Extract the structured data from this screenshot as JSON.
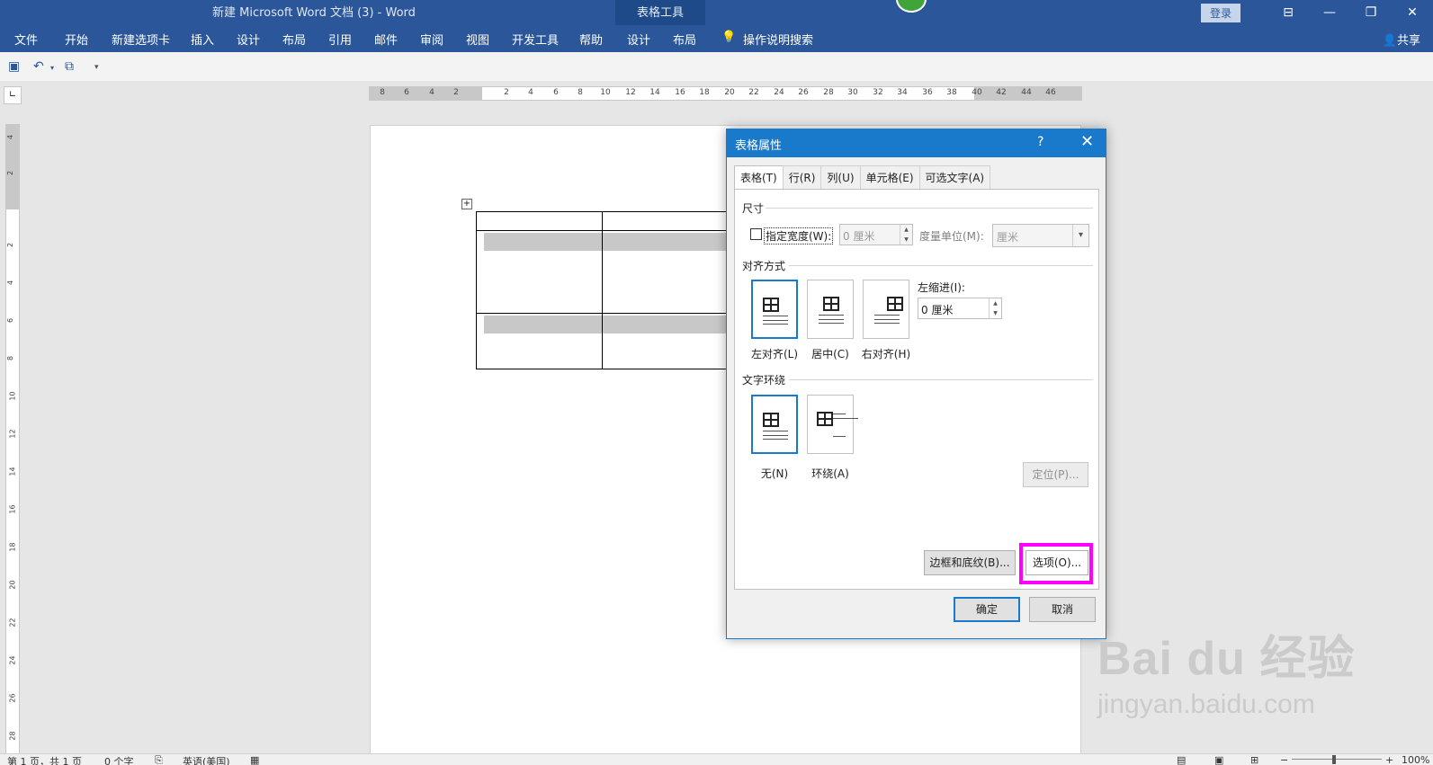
{
  "window": {
    "title": "新建 Microsoft Word 文档 (3)  -  Word",
    "context_title": "表格工具",
    "login": "登录",
    "share": "共享"
  },
  "ribbon_tabs": [
    "文件",
    "开始",
    "新建选项卡",
    "插入",
    "设计",
    "布局",
    "引用",
    "邮件",
    "审阅",
    "视图",
    "开发工具",
    "帮助",
    "设计",
    "布局"
  ],
  "tell_me": "操作说明搜索",
  "hruler_ticks": [
    "8",
    "6",
    "4",
    "2",
    "2",
    "4",
    "6",
    "8",
    "10",
    "12",
    "14",
    "16",
    "18",
    "20",
    "22",
    "24",
    "26",
    "28",
    "30",
    "32",
    "34",
    "36",
    "38",
    "40",
    "42",
    "44",
    "46"
  ],
  "vruler_ticks": [
    "4",
    "2",
    "2",
    "4",
    "6",
    "8",
    "10",
    "12",
    "14",
    "16",
    "18",
    "20",
    "22",
    "24",
    "26",
    "28"
  ],
  "dialog": {
    "title": "表格属性",
    "help": "?",
    "close": "✕",
    "tabs": [
      "表格(T)",
      "行(R)",
      "列(U)",
      "单元格(E)",
      "可选文字(A)"
    ],
    "size_section": "尺寸",
    "preferred_width_label": "指定宽度(W):",
    "preferred_width_value": "0 厘米",
    "measure_label": "度量单位(M):",
    "measure_value": "厘米",
    "alignment_section": "对齐方式",
    "align_options": [
      "左对齐(L)",
      "居中(C)",
      "右对齐(H)"
    ],
    "indent_label": "左缩进(I):",
    "indent_value": "0 厘米",
    "wrap_section": "文字环绕",
    "wrap_options": [
      "无(N)",
      "环绕(A)"
    ],
    "position_button": "定位(P)...",
    "borders_button": "边框和底纹(B)...",
    "options_button": "选项(O)...",
    "ok_button": "确定",
    "cancel_button": "取消"
  },
  "status": {
    "page": "第 1 页，共 1 页",
    "words": "0 个字",
    "language": "英语(美国)",
    "zoom": "100%"
  },
  "watermark": {
    "brand": "Bai du 经验",
    "url": "jingyan.baidu.com"
  },
  "colors": {
    "ribbon": "#2b579a",
    "dialog_accent": "#1979ca",
    "highlight": "#ff00ff"
  }
}
